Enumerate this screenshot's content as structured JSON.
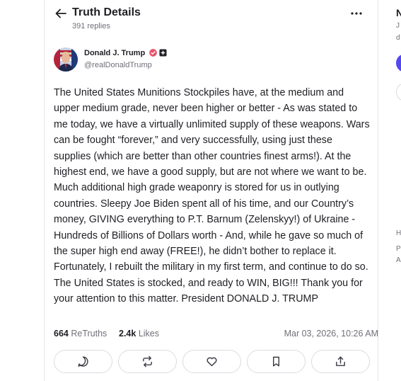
{
  "header": {
    "title": "Truth Details",
    "subtitle": "391 replies"
  },
  "post": {
    "author_name": "Donald J. Trump",
    "author_handle": "@realDonaldTrump",
    "text": "The United States Munitions Stockpiles have, at the medium and upper medium grade, never been higher or better - As was stated to me today, we have a virtually unlimited supply of these weapons. Wars can be fought “forever,” and very successfully, using just these supplies (which are better than other countries finest arms!). At the highest end, we have a good supply, but are not where we want to be. Much additional high grade weaponry is stored for us in outlying countries. Sleepy Joe Biden spent all of his time, and our Country’s money, GIVING everything to P.T. Barnum (Zelenskyy!) of Ukraine - Hundreds of Billions of Dollars worth - And, while he gave so much of the super high end away (FREE!), he didn’t bother to replace it. Fortunately, I rebuilt the military in my first term, and continue to do so. The United States is stocked, and ready to WIN, BIG!!! Thank you for your attention to this matter. President DONALD J. TRUMP",
    "retruths_count": "664",
    "retruths_label": "ReTruths",
    "likes_count": "2.4k",
    "likes_label": "Likes",
    "date": "Mar 03, 2026, 10:26 AM"
  },
  "actions": [
    "reply-icon",
    "retruth-icon",
    "like-icon",
    "bookmark-icon",
    "share-icon"
  ],
  "right_sidebar": {
    "head": "N",
    "line1": "J",
    "line2": "d",
    "line3": "H",
    "line4": "P",
    "line5": "A"
  },
  "colors": {
    "verified": "#e8546b",
    "accent": "#5448ee",
    "text": "#1f1f24",
    "muted": "#6f6f78"
  }
}
